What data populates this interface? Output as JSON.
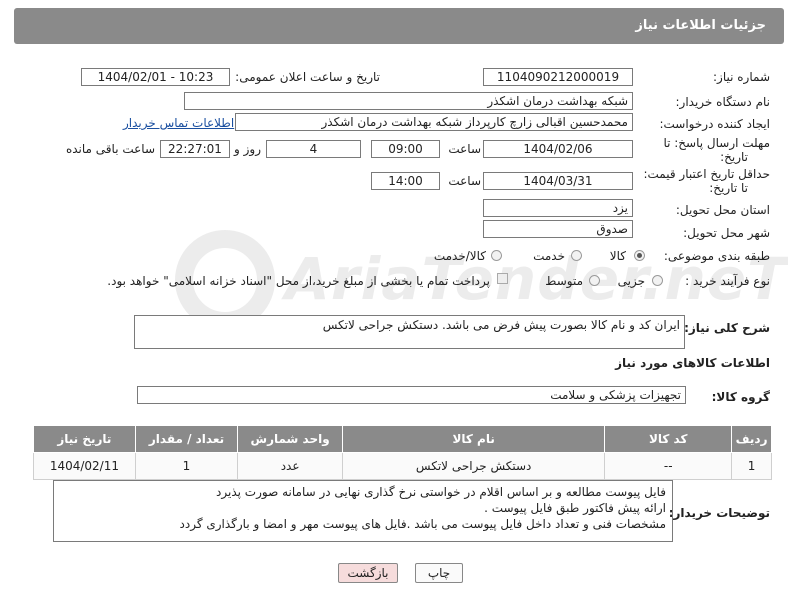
{
  "header": {
    "title": "جزئیات اطلاعات نیاز"
  },
  "form": {
    "need_number_label": "شماره نیاز:",
    "need_number": "1104090212000019",
    "announce_label": "تاریخ و ساعت اعلان عمومی:",
    "announce_value": "1404/02/01 - 10:23",
    "buyer_org_label": "نام دستگاه خریدار:",
    "buyer_org": "شبکه بهداشت درمان اشکذر",
    "creator_label": "ایجاد کننده درخواست:",
    "creator": "محمدحسین اقبالی زارچ کارپرداز شبکه بهداشت درمان اشکذر",
    "contact_link": "اطلاعات تماس خریدار",
    "deadline_label_1": "مهلت ارسال پاسخ: تا",
    "deadline_label_2": "تاریخ:",
    "deadline_date": "1404/02/06",
    "time_label": "ساعت",
    "deadline_time": "09:00",
    "days_value": "4",
    "days_label": "روز و",
    "remaining_time": "22:27:01",
    "remaining_label": "ساعت باقی مانده",
    "validity_label_1": "حداقل تاریخ اعتبار قیمت:",
    "validity_label_2": "تا تاریخ:",
    "validity_date": "1404/03/31",
    "validity_time_label": "ساعت",
    "validity_time": "14:00",
    "province_label": "استان محل تحویل:",
    "province": "یزد",
    "city_label": "شهر محل تحویل:",
    "city": "صدوق",
    "category_label": "طبقه بندی موضوعی:",
    "category_options": [
      "کالا",
      "خدمت",
      "کالا/خدمت"
    ],
    "process_label": "نوع فرآیند خرید :",
    "process_options": [
      "جزیی",
      "متوسط"
    ],
    "payment_note": "پرداخت تمام یا بخشی از مبلغ خرید،از محل \"اسناد خزانه اسلامی\" خواهد بود."
  },
  "description": {
    "label": "شرح کلی نیاز:",
    "value": "ایران کد و نام کالا بصورت پیش فرض می باشد. دستکش جراحی لاتکس"
  },
  "goods_section": {
    "title": "اطلاعات کالاهای مورد نیاز",
    "group_label": "گروه کالا:",
    "group_value": "تجهیزات پزشکی و سلامت"
  },
  "table": {
    "headers": [
      "ردیف",
      "کد کالا",
      "نام کالا",
      "واحد شمارش",
      "تعداد / مقدار",
      "تاریخ نیاز"
    ],
    "rows": [
      [
        "1",
        "--",
        "دستکش جراحی لاتکس",
        "عدد",
        "1",
        "1404/02/11"
      ]
    ]
  },
  "buyer_notes": {
    "label": "توضیحات خریدار:",
    "lines": [
      "فایل پیوست مطالعه و بر اساس اقلام در خواستی نرخ گذاری نهایی در سامانه صورت پذیرد",
      "ارائه پیش فاکتور طبق فایل پیوست .",
      "مشخصات فنی و تعداد داخل فایل پیوست می باشد .فایل های پیوست مهر و امضا و بارگذاری گردد"
    ]
  },
  "buttons": {
    "print": "چاپ",
    "back": "بازگشت"
  },
  "watermark": {
    "text": "AriaTender.neT"
  },
  "colors": {
    "header_bg": "#8a8a8a",
    "link": "#1a4fa0",
    "back_btn_bg": "#f6dcdc"
  }
}
